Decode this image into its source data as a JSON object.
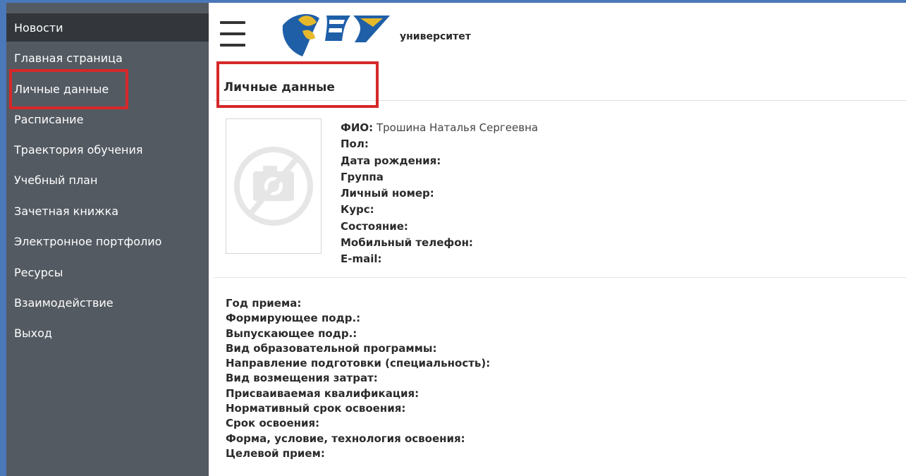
{
  "sidebar": {
    "items": [
      {
        "label": "Новости",
        "active": true
      },
      {
        "label": "Главная страница"
      },
      {
        "label": "Личные данные"
      },
      {
        "label": "Расписание"
      },
      {
        "label": "Траектория обучения"
      },
      {
        "label": "Учебный план"
      },
      {
        "label": "Зачетная книжка"
      },
      {
        "label": "Электронное портфолио"
      },
      {
        "label": "Ресурсы"
      },
      {
        "label": "Взаимодействие"
      },
      {
        "label": "Выход"
      }
    ]
  },
  "header": {
    "menu_icon": "hamburger-icon",
    "logo_icon": "university-logo",
    "brand": "университет"
  },
  "page_title": "Личные данные",
  "profile": {
    "photo_icon": "no-photo-icon",
    "fields": [
      {
        "label": "ФИО:",
        "value": " Трошина Наталья Сергеевна"
      },
      {
        "label": "Пол:",
        "value": ""
      },
      {
        "label": "Дата рождения:",
        "value": ""
      },
      {
        "label": "Группа",
        "value": ""
      },
      {
        "label": "Личный номер:",
        "value": ""
      },
      {
        "label": "Курс:",
        "value": ""
      },
      {
        "label": "Состояние:",
        "value": ""
      },
      {
        "label": "Мобильный телефон:",
        "value": ""
      },
      {
        "label": "E-mail:",
        "value": ""
      }
    ]
  },
  "details": {
    "fields": [
      {
        "label": "Год приема:"
      },
      {
        "label": "Формирующее подр.:"
      },
      {
        "label": "Выпускающее подр.:"
      },
      {
        "label": "Вид образовательной программы:"
      },
      {
        "label": "Направление подготовки (специальность):"
      },
      {
        "label": "Вид возмещения затрат:"
      },
      {
        "label": "Присваиваемая квалификация:"
      },
      {
        "label": "Нормативный срок освоения:"
      },
      {
        "label": "Срок освоения:"
      },
      {
        "label": "Форма, условие, технология освоения:"
      },
      {
        "label": "Целевой прием:"
      }
    ]
  },
  "colors": {
    "sidebar_bg": "#535a62",
    "sidebar_active": "#33373c",
    "highlight": "#d6282a",
    "accent_blue": "#4a78b9",
    "logo_blue": "#1f5fa8",
    "logo_yellow": "#e6b92b"
  }
}
